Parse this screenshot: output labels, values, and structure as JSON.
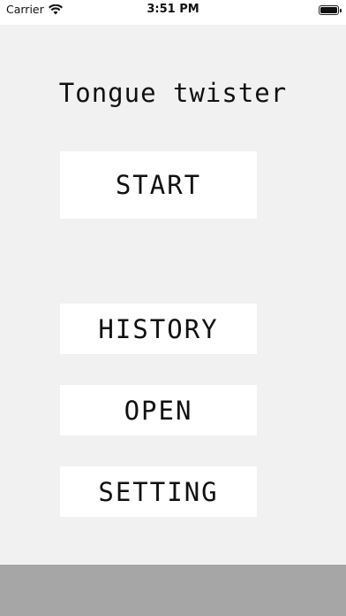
{
  "status_bar": {
    "carrier": "Carrier",
    "time": "3:51 PM",
    "wifi_icon": "wifi-icon",
    "battery_icon": "battery-icon"
  },
  "title": "Tongue twister",
  "menu": {
    "start_label": "START",
    "history_label": "HISTORY",
    "open_label": "OPEN",
    "setting_label": "SETTING"
  },
  "colors": {
    "background": "#f1f1f1",
    "button": "#ffffff",
    "bottom_bar": "#a6a6a6"
  }
}
